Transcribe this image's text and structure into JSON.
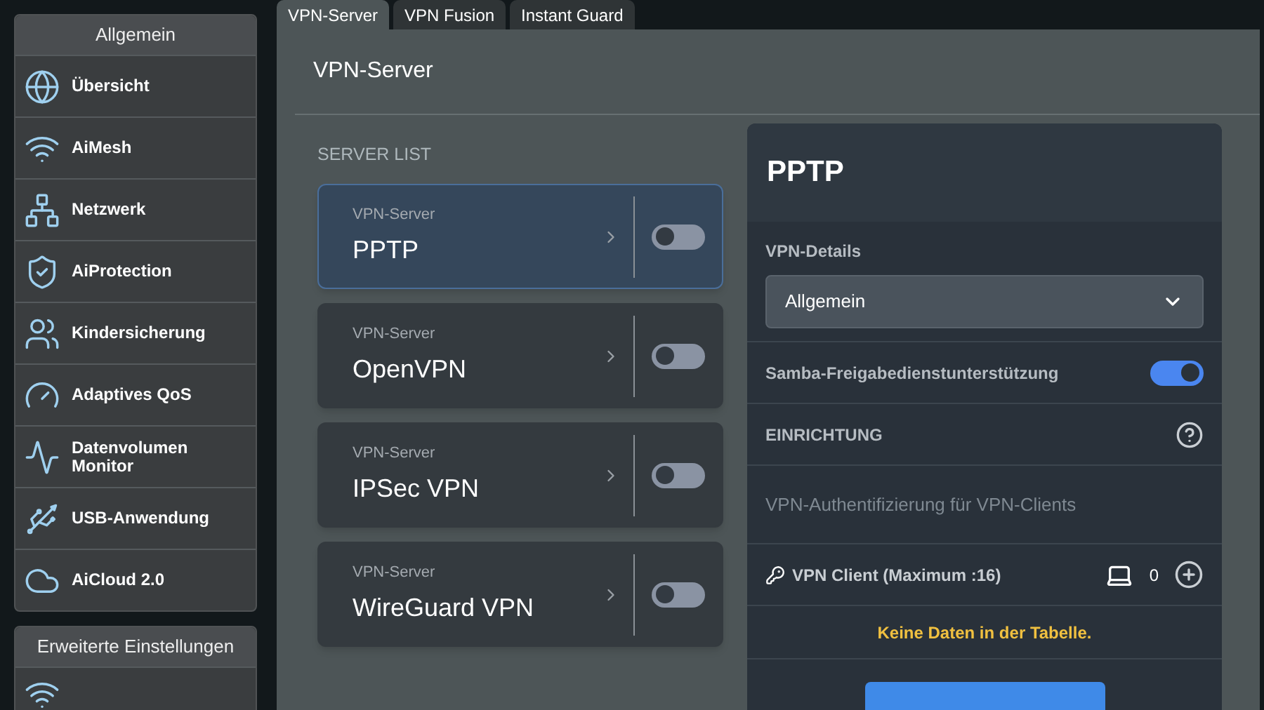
{
  "sidebar": {
    "sections": [
      {
        "title": "Allgemein",
        "items": [
          {
            "label": "Übersicht"
          },
          {
            "label": "AiMesh"
          },
          {
            "label": "Netzwerk"
          },
          {
            "label": "AiProtection"
          },
          {
            "label": "Kindersicherung"
          },
          {
            "label": "Adaptives QoS"
          },
          {
            "label": "Datenvolumen Monitor"
          },
          {
            "label": "USB-Anwendung"
          },
          {
            "label": "AiCloud 2.0"
          }
        ]
      },
      {
        "title": "Erweiterte Einstellungen"
      }
    ]
  },
  "tabs": [
    {
      "label": "VPN-Server",
      "selected": true
    },
    {
      "label": "VPN Fusion",
      "selected": false
    },
    {
      "label": "Instant Guard",
      "selected": false
    }
  ],
  "page_title": "VPN-Server",
  "server_list": {
    "title": "SERVER LIST",
    "items": [
      {
        "caption": "VPN-Server",
        "name": "PPTP",
        "selected": true,
        "on": false
      },
      {
        "caption": "VPN-Server",
        "name": "OpenVPN",
        "selected": false,
        "on": false
      },
      {
        "caption": "VPN-Server",
        "name": "IPSec VPN",
        "selected": false,
        "on": false
      },
      {
        "caption": "VPN-Server",
        "name": "WireGuard VPN",
        "selected": false,
        "on": false
      }
    ]
  },
  "detail": {
    "title": "PPTP",
    "details_label": "VPN-Details",
    "details_select": "Allgemein",
    "samba": {
      "label": "Samba-Freigabedienstunterstützung",
      "on": true
    },
    "setup_title": "EINRICHTUNG",
    "auth_text": "VPN-Authentifizierung für VPN-Clients",
    "client": {
      "label": "VPN Client (Maximum :16)",
      "count": "0"
    },
    "empty_text": "Keine Daten in der Tabelle."
  }
}
